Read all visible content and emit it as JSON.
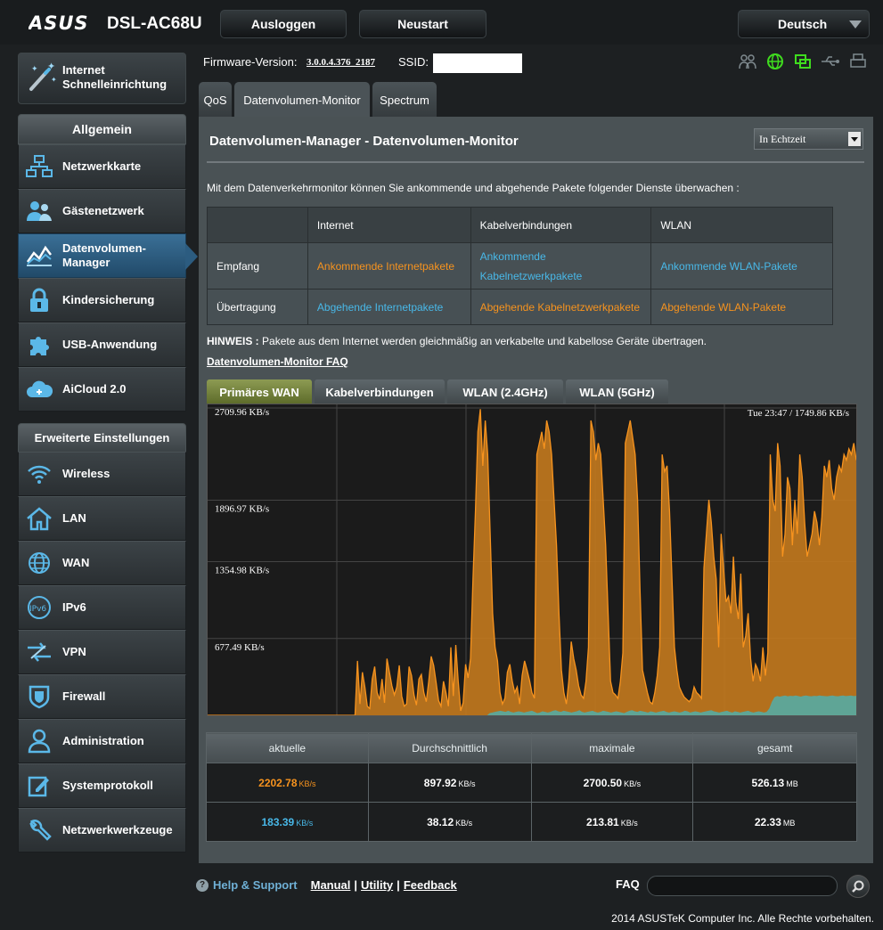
{
  "header": {
    "brand": "ASUS",
    "model": "DSL-AC68U",
    "logout_label": "Ausloggen",
    "restart_label": "Neustart",
    "language": "Deutsch"
  },
  "sidebar": {
    "quick_setup": "Internet Schnelleinrichtung",
    "general_title": "Allgemein",
    "general_items": [
      {
        "label": "Netzwerkkarte"
      },
      {
        "label": "Gästenetzwerk"
      },
      {
        "label": "Datenvolumen-Manager"
      },
      {
        "label": "Kindersicherung"
      },
      {
        "label": "USB-Anwendung"
      },
      {
        "label": "AiCloud 2.0"
      }
    ],
    "advanced_title": "Erweiterte Einstellungen",
    "advanced_items": [
      {
        "label": "Wireless"
      },
      {
        "label": "LAN"
      },
      {
        "label": "WAN"
      },
      {
        "label": "IPv6"
      },
      {
        "label": "VPN"
      },
      {
        "label": "Firewall"
      },
      {
        "label": "Administration"
      },
      {
        "label": "Systemprotokoll"
      },
      {
        "label": "Netzwerkwerkzeuge"
      }
    ]
  },
  "info": {
    "firmware_label": "Firmware-Version:",
    "firmware_value": "3.0.0.4.376_2187",
    "ssid_label": "SSID:",
    "ssid_value": ""
  },
  "tabs": [
    {
      "label": "QoS"
    },
    {
      "label": "Datenvolumen-Monitor"
    },
    {
      "label": "Spectrum"
    }
  ],
  "main": {
    "title": "Datenvolumen-Manager - Datenvolumen-Monitor",
    "mode_select": "In Echtzeit",
    "description": "Mit dem Datenverkehrmonitor können Sie ankommende und abgehende Pakete folgender Dienste überwachen :",
    "service_table": {
      "headers": [
        "",
        "Internet",
        "Kabelverbindungen",
        "WLAN"
      ],
      "rows": [
        {
          "label": "Empfang",
          "cells": [
            "Ankommende Internetpakete",
            "Ankommende Kabelnetzwerkpakete",
            "Ankommende WLAN-Pakete"
          ]
        },
        {
          "label": "Übertragung",
          "cells": [
            "Abgehende Internetpakete",
            "Abgehende Kabelnetzwerkpakete",
            "Abgehende WLAN-Pakete"
          ]
        }
      ]
    },
    "note_label": "HINWEIS :",
    "note_text": "Pakete aus dem Internet werden gleichmäßig an verkabelte und kabellose Geräte übertragen.",
    "faq_link": "Datenvolumen-Monitor FAQ",
    "chart_tabs": [
      {
        "label": "Primäres WAN"
      },
      {
        "label": "Kabelverbindungen"
      },
      {
        "label": "WLAN (2.4GHz)"
      },
      {
        "label": "WLAN (5GHz)"
      }
    ],
    "stats": {
      "headers": [
        "aktuelle",
        "Durchschnittlich",
        "maximale",
        "gesamt"
      ],
      "rows": [
        {
          "values": [
            "2202.78",
            "897.92",
            "2700.50",
            "526.13"
          ],
          "units": [
            "KB/s",
            "KB/s",
            "KB/s",
            "MB"
          ]
        },
        {
          "values": [
            "183.39",
            "38.12",
            "213.81",
            "22.33"
          ],
          "units": [
            "KB/s",
            "KB/s",
            "KB/s",
            "MB"
          ]
        }
      ]
    }
  },
  "chart_data": {
    "type": "area",
    "timestamp_label": "Tue 23:47 / 1749.86 KB/s",
    "y_tick_labels": [
      "2709.96 KB/s",
      "1896.97 KB/s",
      "1354.98 KB/s",
      "677.49 KB/s"
    ],
    "y_ticks": [
      2709.96,
      1896.97,
      1354.98,
      677.49
    ],
    "ylim": [
      0,
      2709.96
    ],
    "colors": {
      "reception": "#c47a1e",
      "reception_line": "#f7931e",
      "transmission": "#5fa596",
      "grid": "#444444"
    },
    "series": [
      {
        "values": [
          0,
          0,
          0,
          0,
          0,
          0,
          0,
          0,
          0,
          0,
          0,
          0,
          0,
          0,
          0,
          0,
          0,
          0,
          0,
          0,
          0,
          0,
          0,
          0,
          0,
          0,
          0,
          0,
          0,
          0,
          0,
          0,
          0,
          0,
          0,
          0,
          0,
          0,
          0,
          0,
          0,
          0,
          0,
          0,
          0,
          0,
          0,
          0,
          0,
          0,
          0,
          0,
          0,
          0,
          0,
          0,
          0,
          0,
          0,
          0,
          0,
          480,
          100,
          380,
          250,
          80,
          60,
          320,
          430,
          200,
          140,
          320,
          110,
          500,
          380,
          260,
          180,
          250,
          440,
          170,
          80,
          100,
          430,
          350,
          180,
          90,
          320,
          360,
          200,
          120,
          300,
          520,
          440,
          290,
          130,
          80,
          300,
          200,
          80,
          600,
          170,
          620,
          300,
          40,
          110,
          450,
          330,
          500,
          1200,
          1800,
          2500,
          2700,
          2200,
          2600,
          2300,
          1600,
          900,
          600,
          480,
          200,
          100,
          150,
          380,
          450,
          300,
          200,
          250,
          100,
          350,
          480,
          400,
          310,
          200,
          150,
          2300,
          2400,
          2500,
          2350,
          2600,
          2500,
          2300,
          1900,
          1500,
          900,
          400,
          200,
          100,
          300,
          650,
          500,
          400,
          260,
          180,
          150,
          300,
          600,
          2600,
          2500,
          2250,
          2400,
          2300,
          1900,
          1500,
          900,
          300,
          200,
          180,
          150,
          300,
          550,
          2400,
          2500,
          2600,
          2450,
          2300,
          1900,
          1100,
          400,
          300,
          200,
          120,
          100,
          200,
          350,
          600,
          2300,
          2150,
          2200,
          1800,
          1200,
          600,
          400,
          250,
          200,
          160,
          140,
          120,
          150,
          250,
          200,
          180,
          150,
          1300,
          1600,
          1900,
          1700,
          1400,
          1200,
          600,
          1600,
          1300,
          1000,
          1050,
          900,
          1400,
          1000,
          850,
          1250,
          600,
          700,
          900,
          500,
          300,
          450,
          400,
          300,
          600,
          350,
          550,
          2300,
          1900,
          1800,
          2400,
          2200,
          1400,
          1600,
          2100,
          2000,
          1500,
          1900,
          1600,
          2300,
          2100,
          1700,
          1400,
          1500,
          1600,
          1800,
          1700,
          1500,
          1750,
          2200,
          2100,
          2250,
          2000,
          1900,
          2100,
          2200,
          2150,
          2300,
          2250,
          2350,
          2300,
          2400,
          2250
        ]
      },
      {
        "values": [
          0,
          0,
          0,
          0,
          0,
          0,
          0,
          0,
          0,
          0,
          0,
          0,
          0,
          0,
          0,
          0,
          0,
          0,
          0,
          0,
          0,
          0,
          0,
          0,
          0,
          0,
          0,
          0,
          0,
          0,
          0,
          0,
          0,
          0,
          0,
          0,
          0,
          0,
          0,
          0,
          0,
          0,
          0,
          0,
          0,
          0,
          0,
          0,
          0,
          0,
          0,
          0,
          0,
          0,
          0,
          0,
          0,
          0,
          0,
          0,
          0,
          0,
          0,
          0,
          0,
          0,
          0,
          0,
          0,
          0,
          0,
          0,
          0,
          0,
          0,
          0,
          0,
          0,
          0,
          0,
          0,
          0,
          0,
          0,
          0,
          0,
          0,
          0,
          0,
          0,
          0,
          0,
          0,
          0,
          0,
          0,
          0,
          0,
          0,
          0,
          0,
          0,
          0,
          0,
          0,
          0,
          0,
          20,
          25,
          30,
          35,
          40,
          35,
          30,
          40,
          30,
          25,
          30,
          35,
          30,
          25,
          30,
          35,
          40,
          30,
          20,
          25,
          35,
          30,
          25,
          30,
          40,
          45,
          35,
          30,
          40,
          35,
          30,
          25,
          30,
          35,
          45,
          30,
          25,
          30,
          35,
          40,
          30,
          25,
          30,
          40,
          35,
          30,
          25,
          30,
          35,
          30,
          25,
          20,
          30,
          40,
          45,
          35,
          30,
          40,
          35,
          30,
          25,
          35,
          30,
          25,
          30,
          35,
          40,
          30,
          25,
          30,
          35,
          30,
          25,
          30,
          40,
          35,
          25,
          30,
          35,
          30,
          25,
          30,
          35,
          40,
          45,
          35,
          30,
          25,
          30,
          35,
          40,
          30,
          25,
          35,
          30,
          25,
          30,
          35,
          40,
          30,
          25,
          30,
          35,
          30,
          25,
          30,
          60,
          120,
          160,
          170,
          165,
          170,
          175,
          168,
          172,
          170,
          175,
          170,
          165,
          172,
          175,
          170,
          168,
          172,
          170,
          175,
          172,
          170,
          168,
          172,
          175,
          170,
          168,
          172,
          175,
          170,
          172,
          175,
          170,
          172
        ]
      }
    ]
  }
}
